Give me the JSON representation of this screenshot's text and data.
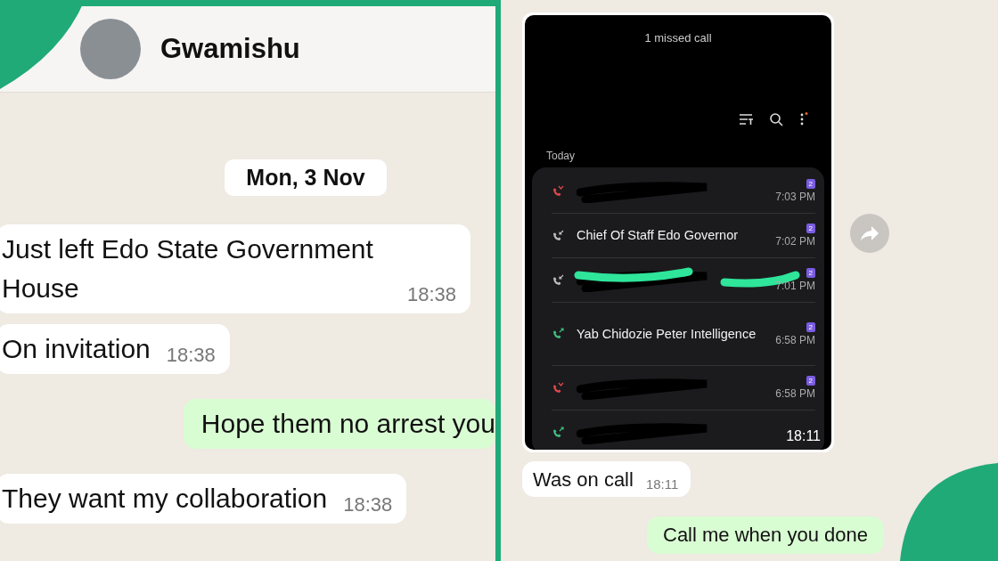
{
  "left_chat": {
    "contact": {
      "name": "Gwamishu"
    },
    "date": "Mon, 3 Nov",
    "messages": [
      {
        "outgoing": false,
        "text": "Just left Edo State Government House",
        "time": "18:38"
      },
      {
        "outgoing": false,
        "text": "On invitation",
        "time": "18:38"
      },
      {
        "outgoing": true,
        "text": "Hope them no arrest you"
      },
      {
        "outgoing": false,
        "text": "They want my collaboration",
        "time": "18:38"
      }
    ]
  },
  "right_chat": {
    "screenshot": {
      "subtitle": "1 missed call",
      "section": "Today",
      "time": "18:11",
      "calls": [
        {
          "kind": "missed",
          "redacted": true,
          "sim": "2",
          "time": "7:03 PM"
        },
        {
          "kind": "incoming",
          "redacted": false,
          "name": "Chief Of Staff Edo Governor",
          "sim": "2",
          "time": "7:02 PM"
        },
        {
          "kind": "incoming",
          "redacted": true,
          "sim": "2",
          "time": "7:01 PM"
        },
        {
          "kind": "outgoing",
          "redacted": false,
          "name": "Yab Chidozie Peter Intelligence",
          "sim": "2",
          "time": "6:58 PM"
        },
        {
          "kind": "missed",
          "redacted": true,
          "sim": "2",
          "time": "6:58 PM"
        },
        {
          "kind": "outgoing",
          "redacted": true
        }
      ]
    },
    "messages": [
      {
        "outgoing": false,
        "text": "Was on call",
        "time": "18:11"
      },
      {
        "outgoing": true,
        "text": "Call me when you done"
      }
    ]
  }
}
